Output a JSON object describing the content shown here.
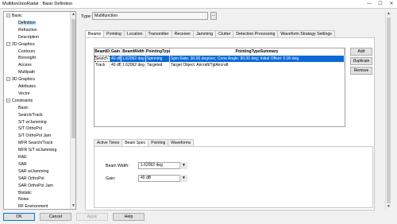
{
  "window": {
    "title": "MultifunctionRadar : Basic Definition",
    "minimize": "—",
    "maximize": "☐",
    "close": "✕"
  },
  "tree": [
    {
      "label": "Basic",
      "level": 0,
      "expander": "−"
    },
    {
      "label": "Definition",
      "level": 1,
      "selected": true
    },
    {
      "label": "Refraction",
      "level": 1
    },
    {
      "label": "Description",
      "level": 1
    },
    {
      "label": "2D Graphics",
      "level": 0,
      "expander": "−"
    },
    {
      "label": "Contours",
      "level": 1
    },
    {
      "label": "Boresight",
      "level": 1
    },
    {
      "label": "Access",
      "level": 1
    },
    {
      "label": "Multipath",
      "level": 1
    },
    {
      "label": "3D Graphics",
      "level": 0,
      "expander": "−"
    },
    {
      "label": "Attributes",
      "level": 1
    },
    {
      "label": "Vector",
      "level": 1
    },
    {
      "label": "Constraints",
      "level": 0,
      "expander": "−"
    },
    {
      "label": "Basic",
      "level": 1
    },
    {
      "label": "Search/Track",
      "level": 1
    },
    {
      "label": "S/T w/Jamming",
      "level": 1
    },
    {
      "label": "S/T OrthoPol",
      "level": 1
    },
    {
      "label": "S/T OrthoPol Jam",
      "level": 1
    },
    {
      "label": "MFR Search/Track",
      "level": 1
    },
    {
      "label": "MFR S/T w/Jamming",
      "level": 1
    },
    {
      "label": "RAE",
      "level": 1
    },
    {
      "label": "SAR",
      "level": 1
    },
    {
      "label": "SAR w/Jamming",
      "level": 1
    },
    {
      "label": "SAR OrthoPol",
      "level": 1
    },
    {
      "label": "SAR OrthoPol Jam",
      "level": 1
    },
    {
      "label": "Bistatic",
      "level": 1
    },
    {
      "label": "Noise",
      "level": 1
    },
    {
      "label": "RF Environment",
      "level": 1
    }
  ],
  "type": {
    "label": "Type:",
    "value": "Multifunction",
    "button": "..."
  },
  "tabs": [
    {
      "label": "Beams",
      "active": true
    },
    {
      "label": "Pointing"
    },
    {
      "label": "Location"
    },
    {
      "label": "Transmitter"
    },
    {
      "label": "Receiver"
    },
    {
      "label": "Jamming"
    },
    {
      "label": "Clutter"
    },
    {
      "label": "Detection Processing"
    },
    {
      "label": "Waveform Strategy Settings"
    }
  ],
  "grid": {
    "columns": [
      "BeamID",
      "Gain",
      "BeamWidth",
      "PointingType",
      "PointingTypeSummary"
    ],
    "rows": [
      {
        "cells": [
          "Search",
          "40 dB",
          "1.62062 deg",
          "Spinning",
          "Spin Rate: 30.00 deg/sec; Cone Angle: 90.00 deg; Initial Offset: 0.00 deg"
        ],
        "selected": true
      },
      {
        "cells": [
          "Track",
          "40 dB",
          "1.62062 deg",
          "Targeted",
          "Target Object: Aircraft/TgtAircraft"
        ]
      }
    ]
  },
  "side_buttons": [
    "Add",
    "Duplicate",
    "Remove"
  ],
  "subtabs": [
    {
      "label": "Active Times"
    },
    {
      "label": "Beam Spec",
      "active": true
    },
    {
      "label": "Pointing"
    },
    {
      "label": "Waveforms"
    }
  ],
  "beam_spec": {
    "beam_width_label": "Beam Width:",
    "beam_width_value": "1.62062 deg",
    "gain_label": "Gain:",
    "gain_value": "40 dB"
  },
  "bottom_buttons": [
    {
      "label": "OK",
      "primary": true
    },
    {
      "label": "Cancel"
    },
    {
      "label": "Apply",
      "disabled": true
    },
    {
      "label": "Help"
    }
  ]
}
